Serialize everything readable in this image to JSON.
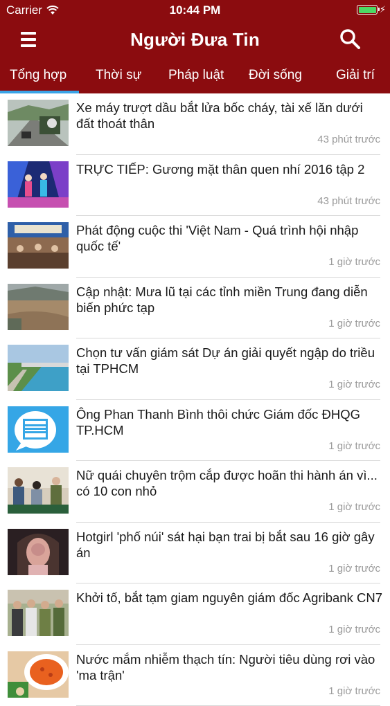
{
  "status_bar": {
    "carrier": "Carrier",
    "time": "10:44 PM",
    "battery_level": 1.0,
    "icons": [
      "wifi-icon",
      "battery-icon",
      "charging-icon"
    ]
  },
  "nav": {
    "title": "Người Đưa Tin",
    "icons": [
      "menu-icon",
      "search-icon"
    ]
  },
  "tabs": {
    "items": [
      "Tổng hợp",
      "Thời sự",
      "Pháp luật",
      "Đời sống",
      "Giải trí"
    ],
    "active_index": 0
  },
  "colors": {
    "header": "#8b0c0f",
    "tab_indicator": "#3aa3e6",
    "timestamp": "#9a9a9a",
    "headline": "#1a1a1a"
  },
  "articles": [
    {
      "title": "Xe máy trượt dầu bắt lửa bốc cháy, tài xế lăn dưới đất thoát thân",
      "time": "43 phút trước",
      "thumb_icon": "road-motorbike-thumbnail"
    },
    {
      "title": "TRỰC TIẾP: Gương mặt thân quen nhí 2016 tập 2",
      "time": "43 phút trước",
      "thumb_icon": "stage-performance-thumbnail"
    },
    {
      "title": "Phát động cuộc thi 'Việt Nam - Quá trình hội nhập quốc tế'",
      "time": "1 giờ trước",
      "thumb_icon": "conference-room-thumbnail"
    },
    {
      "title": "Cập nhật: Mưa lũ tại các tỉnh miền Trung đang diễn biến phức tạp",
      "time": "1 giờ trước",
      "thumb_icon": "flood-river-thumbnail"
    },
    {
      "title": "Chọn tư vấn giám sát Dự án giải quyết ngập do triều tại TPHCM",
      "time": "1 giờ trước",
      "thumb_icon": "canal-embankment-thumbnail"
    },
    {
      "title": "Ông Phan Thanh Bình thôi chức Giám đốc ĐHQG TP.HCM",
      "time": "1 giờ trước",
      "thumb_icon": "news-placeholder-thumbnail"
    },
    {
      "title": "Nữ quái chuyên trộm cắp được hoãn thi hành án vì... có 10 con nhỏ",
      "time": "1 giờ trước",
      "thumb_icon": "courtroom-thumbnail"
    },
    {
      "title": "Hotgirl 'phố núi' sát hại bạn trai bị bắt sau 16 giờ gây án",
      "time": "1 giờ trước",
      "thumb_icon": "portrait-thumbnail"
    },
    {
      "title": "Khởi tố, bắt tạm giam nguyên giám đốc Agribank CN7",
      "time": "1 giờ trước",
      "thumb_icon": "police-escort-thumbnail"
    },
    {
      "title": "Nước mắm nhiễm thạch tín: Người tiêu dùng rơi vào 'ma trận'",
      "time": "1 giờ trước",
      "thumb_icon": "fish-sauce-dish-thumbnail"
    }
  ]
}
